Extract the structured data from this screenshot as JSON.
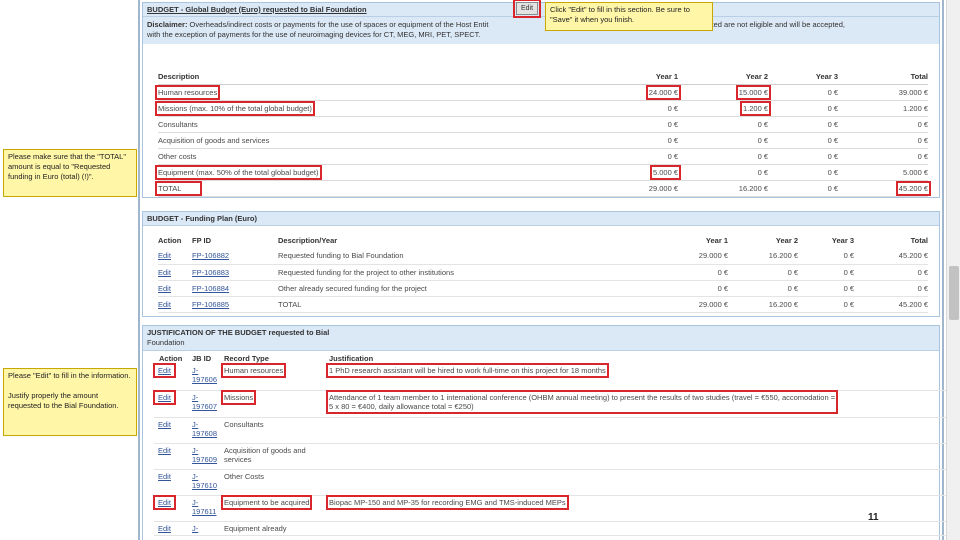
{
  "budget": {
    "header": "BUDGET - Global Budget (Euro) requested to Bial Foundation",
    "edit_label": "Edit",
    "disclaimer_label": "Disclaimer:",
    "disclaimer_text_1": "Overheads/indirect costs or payments for the use of spaces or equipment of the Host Entit",
    "disclaimer_text_1b": "will be conducted are not eligible and will be accepted,",
    "disclaimer_text_2": "with the exception of payments for the use of neuroimaging devices for CT, MEG, MRI, PET, SPECT.",
    "columns": [
      "Description",
      "Year 1",
      "Year 2",
      "Year 3",
      "Total"
    ],
    "rows": [
      {
        "desc": "Human resources",
        "y1": "24.000 €",
        "y2": "15.000 €",
        "y3": "0 €",
        "total": "39.000 €"
      },
      {
        "desc": "Missions (max. 10% of the total global budget)",
        "y1": "0 €",
        "y2": "1.200 €",
        "y3": "0 €",
        "total": "1.200 €"
      },
      {
        "desc": "Consultants",
        "y1": "0 €",
        "y2": "0 €",
        "y3": "0 €",
        "total": "0 €"
      },
      {
        "desc": "Acquisition of goods and services",
        "y1": "0 €",
        "y2": "0 €",
        "y3": "0 €",
        "total": "0 €"
      },
      {
        "desc": "Other costs",
        "y1": "0 €",
        "y2": "0 €",
        "y3": "0 €",
        "total": "0 €"
      },
      {
        "desc": "Equipment (max. 50% of the total global budget)",
        "y1": "5.000 €",
        "y2": "0 €",
        "y3": "0 €",
        "total": "5.000 €"
      },
      {
        "desc": "TOTAL",
        "y1": "29.000 €",
        "y2": "16.200 €",
        "y3": "0 €",
        "total": "45.200 €"
      }
    ]
  },
  "callouts": {
    "edit_hint": "Click \"Edit\" to fill in this section. Be sure to \"Save\" it when you finish.",
    "total_hint": "Please make sure that the \"TOTAL\" amount is equal to \"Requested funding in Euro (total) (!)\".",
    "justify_hint_1": "Please \"Edit\" to fill in the information.",
    "justify_hint_2": "Justify properly the amount requested to the Bial Foundation."
  },
  "funding": {
    "header": "BUDGET - Funding Plan (Euro)",
    "columns": [
      "Action",
      "FP ID",
      "Description/Year",
      "Year 1",
      "Year 2",
      "Year 3",
      "Total"
    ],
    "rows": [
      {
        "action": "Edit",
        "id": "FP-106882",
        "desc": "Requested funding to Bial Foundation",
        "y1": "29.000 €",
        "y2": "16.200 €",
        "y3": "0 €",
        "total": "45.200 €"
      },
      {
        "action": "Edit",
        "id": "FP-106883",
        "desc": "Requested funding for the project to other institutions",
        "y1": "0 €",
        "y2": "0 €",
        "y3": "0 €",
        "total": "0 €"
      },
      {
        "action": "Edit",
        "id": "FP-106884",
        "desc": "Other already secured funding for the project",
        "y1": "0 €",
        "y2": "0 €",
        "y3": "0 €",
        "total": "0 €"
      },
      {
        "action": "Edit",
        "id": "FP-106885",
        "desc": "TOTAL",
        "y1": "29.000 €",
        "y2": "16.200 €",
        "y3": "0 €",
        "total": "45.200 €"
      }
    ]
  },
  "justification": {
    "header_1": "JUSTIFICATION OF THE BUDGET requested to Bial",
    "header_2": "Foundation",
    "columns": [
      "Action",
      "JB ID",
      "Record Type",
      "Justification"
    ],
    "rows": [
      {
        "action": "Edit",
        "id_1": "J-",
        "id_2": "197606",
        "type": "Human resources",
        "type_2": "",
        "just_1": "1 PhD research assistant will be hired to work full-time on this project for 18 months",
        "just_2": ""
      },
      {
        "action": "Edit",
        "id_1": "J-",
        "id_2": "197607",
        "type": "Missions",
        "type_2": "",
        "just_1": "Attendance of 1 team member to 1 international conference (OHBM annual meeting) to present the results of two studies (travel = €550, accomodation =",
        "just_2": "5 x 80 = €400, daily allowance total = €250)"
      },
      {
        "action": "Edit",
        "id_1": "J-",
        "id_2": "197608",
        "type": "Consultants",
        "type_2": "",
        "just_1": "",
        "just_2": ""
      },
      {
        "action": "Edit",
        "id_1": "J-",
        "id_2": "197609",
        "type": "Acquisition of goods and",
        "type_2": "services",
        "just_1": "",
        "just_2": ""
      },
      {
        "action": "Edit",
        "id_1": "J-",
        "id_2": "197610",
        "type": "Other Costs",
        "type_2": "",
        "just_1": "",
        "just_2": ""
      },
      {
        "action": "Edit",
        "id_1": "J-",
        "id_2": "197611",
        "type": "Equipment to be acquired",
        "type_2": "",
        "just_1": "Biopac MP-150 and MP-35 for recording EMG and TMS-induced MEPs",
        "just_2": ""
      },
      {
        "action": "Edit",
        "id_1": "J-",
        "id_2": "",
        "type": "Equipment already",
        "type_2": "",
        "just_1": "",
        "just_2": ""
      }
    ]
  },
  "page_number": "11",
  "colors": {
    "highlight": "#d9262c",
    "callout_bg": "#fff6a8",
    "header_bg": "#dbe8f6"
  }
}
